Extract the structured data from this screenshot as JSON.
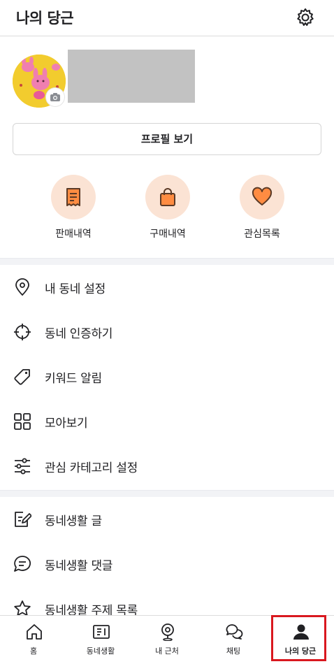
{
  "header": {
    "title": "나의 당근",
    "settings_icon": "gear-icon"
  },
  "profile": {
    "view_button_label": "프로필 보기",
    "avatar_icon": "avatar-image",
    "camera_icon": "camera-icon"
  },
  "quick_actions": [
    {
      "label": "판매내역",
      "icon": "receipt-icon"
    },
    {
      "label": "구매내역",
      "icon": "shopping-bag-icon"
    },
    {
      "label": "관심목록",
      "icon": "heart-icon"
    }
  ],
  "menu_section_1": [
    {
      "label": "내 동네 설정",
      "icon": "location-pin-icon"
    },
    {
      "label": "동네 인증하기",
      "icon": "crosshair-icon"
    },
    {
      "label": "키워드 알림",
      "icon": "tag-icon"
    },
    {
      "label": "모아보기",
      "icon": "grid-icon"
    },
    {
      "label": "관심 카테고리 설정",
      "icon": "sliders-icon"
    }
  ],
  "menu_section_2": [
    {
      "label": "동네생활 글",
      "icon": "edit-note-icon"
    },
    {
      "label": "동네생활 댓글",
      "icon": "comment-icon"
    },
    {
      "label": "동네생활 주제 목록",
      "icon": "star-icon"
    }
  ],
  "tabbar": [
    {
      "label": "홈",
      "icon": "home-icon"
    },
    {
      "label": "동네생활",
      "icon": "newspaper-icon"
    },
    {
      "label": "내 근처",
      "icon": "map-pin-icon"
    },
    {
      "label": "채팅",
      "icon": "chat-icon"
    },
    {
      "label": "나의 당근",
      "icon": "user-icon",
      "active": true
    }
  ],
  "colors": {
    "accent_soft": "#fbe3d4",
    "accent": "#ff7e36",
    "highlight_box": "#d9181f",
    "divider": "#f2f3f6"
  }
}
